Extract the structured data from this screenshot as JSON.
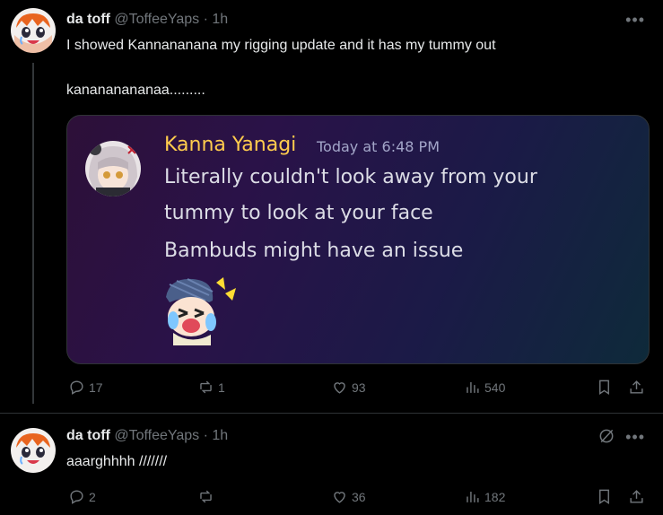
{
  "tweets": [
    {
      "name": "da toff",
      "handle": "@ToffeeYaps",
      "dot": "·",
      "time": "1h",
      "text_line1": "I showed Kannananana my rigging update and it has my tummy out",
      "text_line2": "kanananananaa.........",
      "actions": {
        "replies": "17",
        "retweets": "1",
        "likes": "93",
        "views": "540"
      }
    },
    {
      "name": "da toff",
      "handle": "@ToffeeYaps",
      "dot": "·",
      "time": "1h",
      "text_line1": "aaarghhhh ///////",
      "actions": {
        "replies": "2",
        "retweets": "",
        "likes": "36",
        "views": "182"
      }
    }
  ],
  "embed": {
    "author": "Kanna Yanagi",
    "timestamp": "Today at 6:48 PM",
    "line1": "Literally couldn't look away from your",
    "line2": "tummy to look at your face",
    "line3": "Bambuds might have an issue"
  },
  "icons": {
    "more": "more-options-icon",
    "reply": "reply-icon",
    "retweet": "retweet-icon",
    "like": "heart-icon",
    "views": "views-chart-icon",
    "bookmark": "bookmark-icon",
    "share": "share-icon",
    "grok": "grok-icon"
  },
  "colors": {
    "background": "#000000",
    "text": "#e7e9ea",
    "muted": "#71767b",
    "embed_name": "#ffcc4d"
  }
}
